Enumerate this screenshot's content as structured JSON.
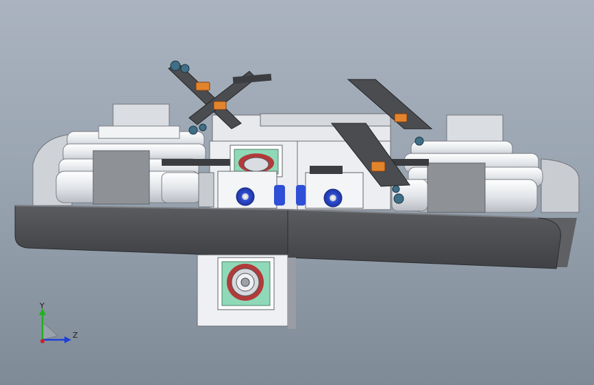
{
  "viewport": {
    "colors": {
      "background_top": "#aab3bf",
      "background_bottom": "#7f8a97",
      "tray": "#4d4f52",
      "housing": "#e9ebee",
      "roller": "#dfe3e8",
      "dark_block": "#8a8d92",
      "flange_green": "#8fd9b8",
      "brake_red": "#b23a3a",
      "hub_blue": "#2f4fd6",
      "motor_orange": "#e2842c",
      "frame_dark": "#3b3d40",
      "joint_teal": "#3f6f86"
    },
    "model": {
      "name": "cad-assembly",
      "icons": [
        "gear-icon",
        "hub-icon",
        "motor-icon"
      ]
    },
    "triad": {
      "y_label": "Y",
      "z_label": "Z",
      "colors": {
        "y": "#1fb21f",
        "z": "#1f3fd6",
        "x": "#d21f1f"
      }
    }
  }
}
